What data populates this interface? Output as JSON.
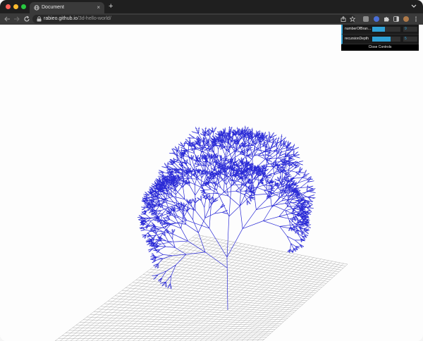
{
  "browser": {
    "tab_title": "Document",
    "tab_close": "×",
    "new_tab": "+",
    "url_host": "rabieo.github.io",
    "url_path": "/3d-hello-world/"
  },
  "controls": {
    "rows": [
      {
        "label": "numberOfBran…",
        "value": "9",
        "fill": 0.45
      },
      {
        "label": "recursionDepth",
        "value": "5",
        "fill": 0.65
      }
    ],
    "close_label": "Close Controls"
  },
  "colors": {
    "tree": "#2b2bd6",
    "grid": "#8f8f8f",
    "slider_accent": "#2fa1d6",
    "page_background": "#fdfdfd"
  },
  "icons": [
    "back-icon",
    "forward-icon",
    "reload-icon",
    "lock-icon",
    "share-icon",
    "star-icon",
    "extension-icon",
    "puzzle-icon",
    "sidepanel-icon",
    "profile-avatar",
    "menu-icon"
  ]
}
